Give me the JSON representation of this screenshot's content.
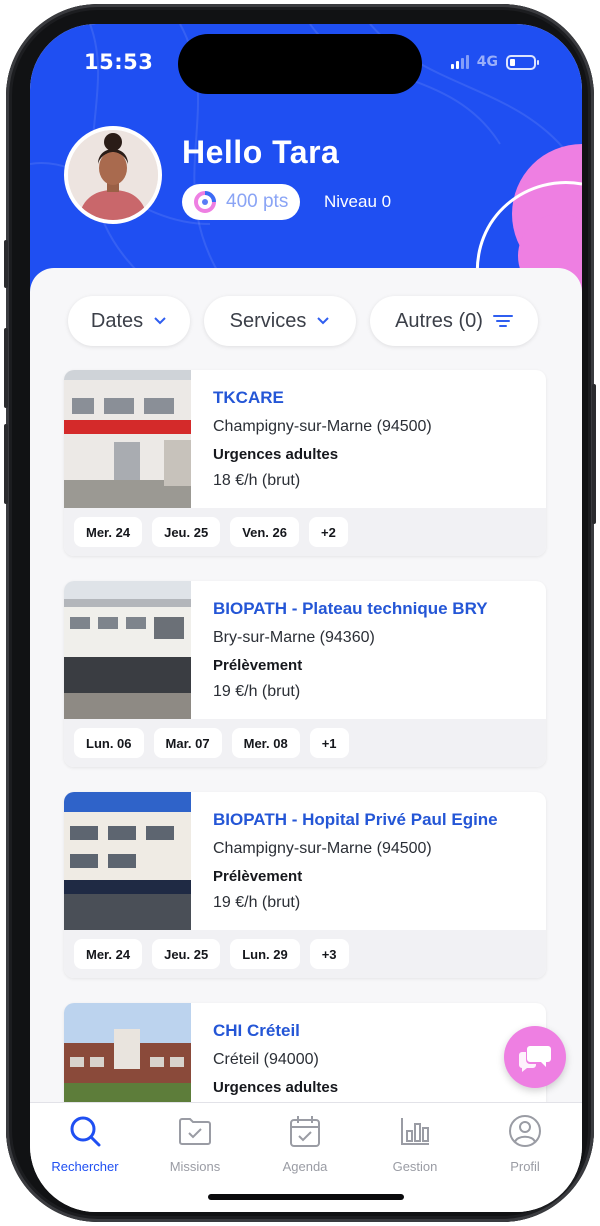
{
  "status": {
    "time": "15:53",
    "network": "4G"
  },
  "header": {
    "greeting": "Hello Tara",
    "points": "400 pts",
    "level": "Niveau 0",
    "avatar_icon": "user-avatar-photo"
  },
  "filters": [
    {
      "label": "Dates",
      "icon": "chevron-down-icon"
    },
    {
      "label": "Services",
      "icon": "chevron-down-icon"
    },
    {
      "label": "Autres (0)",
      "icon": "filter-icon"
    }
  ],
  "offers": [
    {
      "name": "TKCARE",
      "city": "Champigny-sur-Marne (94500)",
      "service": "Urgences adultes",
      "rate": "18 €/h (brut)",
      "dates": [
        "Mer. 24",
        "Jeu. 25",
        "Ven. 26",
        "+2"
      ]
    },
    {
      "name": "BIOPATH - Plateau technique BRY",
      "city": "Bry-sur-Marne (94360)",
      "service": "Prélèvement",
      "rate": "19 €/h (brut)",
      "dates": [
        "Lun. 06",
        "Mar. 07",
        "Mer. 08",
        "+1"
      ]
    },
    {
      "name": "BIOPATH - Hopital Privé Paul Egine",
      "city": "Champigny-sur-Marne (94500)",
      "service": "Prélèvement",
      "rate": "19 €/h (brut)",
      "dates": [
        "Mer. 24",
        "Jeu. 25",
        "Lun. 29",
        "+3"
      ]
    },
    {
      "name": "CHI Créteil",
      "city": "Créteil (94000)",
      "service": "Urgences adultes",
      "rate": "",
      "dates": []
    }
  ],
  "nav": [
    {
      "label": "Rechercher",
      "icon": "search-icon",
      "active": true
    },
    {
      "label": "Missions",
      "icon": "folder-check-icon",
      "active": false
    },
    {
      "label": "Agenda",
      "icon": "calendar-check-icon",
      "active": false
    },
    {
      "label": "Gestion",
      "icon": "bar-chart-icon",
      "active": false
    },
    {
      "label": "Profil",
      "icon": "user-circle-icon",
      "active": false
    }
  ],
  "colors": {
    "brand_blue": "#1f4ff2",
    "title_blue": "#2456d6",
    "accent_pink": "#ee7fe2",
    "nav_inactive": "#9a9ca4"
  }
}
